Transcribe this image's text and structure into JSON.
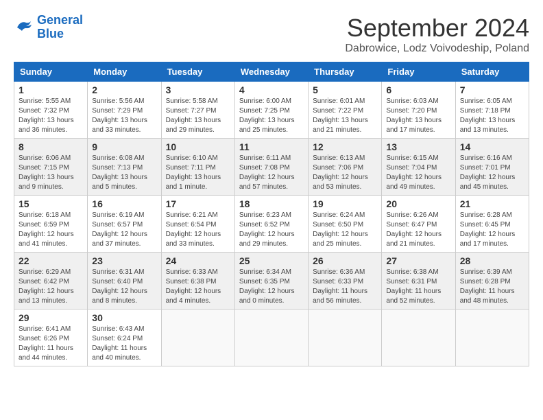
{
  "logo": {
    "line1": "General",
    "line2": "Blue"
  },
  "title": "September 2024",
  "subtitle": "Dabrowice, Lodz Voivodeship, Poland",
  "weekdays": [
    "Sunday",
    "Monday",
    "Tuesday",
    "Wednesday",
    "Thursday",
    "Friday",
    "Saturday"
  ],
  "weeks": [
    [
      {
        "day": "1",
        "info": "Sunrise: 5:55 AM\nSunset: 7:32 PM\nDaylight: 13 hours\nand 36 minutes."
      },
      {
        "day": "2",
        "info": "Sunrise: 5:56 AM\nSunset: 7:29 PM\nDaylight: 13 hours\nand 33 minutes."
      },
      {
        "day": "3",
        "info": "Sunrise: 5:58 AM\nSunset: 7:27 PM\nDaylight: 13 hours\nand 29 minutes."
      },
      {
        "day": "4",
        "info": "Sunrise: 6:00 AM\nSunset: 7:25 PM\nDaylight: 13 hours\nand 25 minutes."
      },
      {
        "day": "5",
        "info": "Sunrise: 6:01 AM\nSunset: 7:22 PM\nDaylight: 13 hours\nand 21 minutes."
      },
      {
        "day": "6",
        "info": "Sunrise: 6:03 AM\nSunset: 7:20 PM\nDaylight: 13 hours\nand 17 minutes."
      },
      {
        "day": "7",
        "info": "Sunrise: 6:05 AM\nSunset: 7:18 PM\nDaylight: 13 hours\nand 13 minutes."
      }
    ],
    [
      {
        "day": "8",
        "info": "Sunrise: 6:06 AM\nSunset: 7:15 PM\nDaylight: 13 hours\nand 9 minutes."
      },
      {
        "day": "9",
        "info": "Sunrise: 6:08 AM\nSunset: 7:13 PM\nDaylight: 13 hours\nand 5 minutes."
      },
      {
        "day": "10",
        "info": "Sunrise: 6:10 AM\nSunset: 7:11 PM\nDaylight: 13 hours\nand 1 minute."
      },
      {
        "day": "11",
        "info": "Sunrise: 6:11 AM\nSunset: 7:08 PM\nDaylight: 12 hours\nand 57 minutes."
      },
      {
        "day": "12",
        "info": "Sunrise: 6:13 AM\nSunset: 7:06 PM\nDaylight: 12 hours\nand 53 minutes."
      },
      {
        "day": "13",
        "info": "Sunrise: 6:15 AM\nSunset: 7:04 PM\nDaylight: 12 hours\nand 49 minutes."
      },
      {
        "day": "14",
        "info": "Sunrise: 6:16 AM\nSunset: 7:01 PM\nDaylight: 12 hours\nand 45 minutes."
      }
    ],
    [
      {
        "day": "15",
        "info": "Sunrise: 6:18 AM\nSunset: 6:59 PM\nDaylight: 12 hours\nand 41 minutes."
      },
      {
        "day": "16",
        "info": "Sunrise: 6:19 AM\nSunset: 6:57 PM\nDaylight: 12 hours\nand 37 minutes."
      },
      {
        "day": "17",
        "info": "Sunrise: 6:21 AM\nSunset: 6:54 PM\nDaylight: 12 hours\nand 33 minutes."
      },
      {
        "day": "18",
        "info": "Sunrise: 6:23 AM\nSunset: 6:52 PM\nDaylight: 12 hours\nand 29 minutes."
      },
      {
        "day": "19",
        "info": "Sunrise: 6:24 AM\nSunset: 6:50 PM\nDaylight: 12 hours\nand 25 minutes."
      },
      {
        "day": "20",
        "info": "Sunrise: 6:26 AM\nSunset: 6:47 PM\nDaylight: 12 hours\nand 21 minutes."
      },
      {
        "day": "21",
        "info": "Sunrise: 6:28 AM\nSunset: 6:45 PM\nDaylight: 12 hours\nand 17 minutes."
      }
    ],
    [
      {
        "day": "22",
        "info": "Sunrise: 6:29 AM\nSunset: 6:42 PM\nDaylight: 12 hours\nand 13 minutes."
      },
      {
        "day": "23",
        "info": "Sunrise: 6:31 AM\nSunset: 6:40 PM\nDaylight: 12 hours\nand 8 minutes."
      },
      {
        "day": "24",
        "info": "Sunrise: 6:33 AM\nSunset: 6:38 PM\nDaylight: 12 hours\nand 4 minutes."
      },
      {
        "day": "25",
        "info": "Sunrise: 6:34 AM\nSunset: 6:35 PM\nDaylight: 12 hours\nand 0 minutes."
      },
      {
        "day": "26",
        "info": "Sunrise: 6:36 AM\nSunset: 6:33 PM\nDaylight: 11 hours\nand 56 minutes."
      },
      {
        "day": "27",
        "info": "Sunrise: 6:38 AM\nSunset: 6:31 PM\nDaylight: 11 hours\nand 52 minutes."
      },
      {
        "day": "28",
        "info": "Sunrise: 6:39 AM\nSunset: 6:28 PM\nDaylight: 11 hours\nand 48 minutes."
      }
    ],
    [
      {
        "day": "29",
        "info": "Sunrise: 6:41 AM\nSunset: 6:26 PM\nDaylight: 11 hours\nand 44 minutes."
      },
      {
        "day": "30",
        "info": "Sunrise: 6:43 AM\nSunset: 6:24 PM\nDaylight: 11 hours\nand 40 minutes."
      },
      {
        "day": "",
        "info": ""
      },
      {
        "day": "",
        "info": ""
      },
      {
        "day": "",
        "info": ""
      },
      {
        "day": "",
        "info": ""
      },
      {
        "day": "",
        "info": ""
      }
    ]
  ]
}
